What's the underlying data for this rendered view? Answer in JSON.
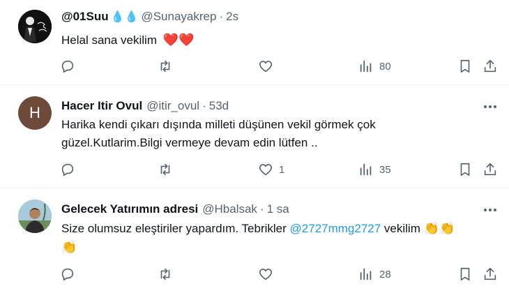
{
  "tweets": [
    {
      "name": "@01Suu",
      "name_suffix": "💧💧",
      "handle": "@Sunayakrep",
      "dot": "·",
      "time": "2s",
      "text": "Helal sana vekilim",
      "text_emoji": "❤️❤️",
      "replies": "",
      "retweets": "",
      "likes": "",
      "views": "80"
    },
    {
      "name": "Hacer Itir Ovul",
      "handle": "@itir_ovul",
      "dot": "·",
      "time": "53d",
      "avatar_letter": "H",
      "text_line1": "Harika kendi çıkarı dışında milleti düşünen vekil görmek çok",
      "text_line2": "güzel.Kutlarim.Bilgi vermeye devam edin lütfen ..",
      "replies": "",
      "retweets": "",
      "likes": "1",
      "views": "35"
    },
    {
      "name": "Gelecek Yatırımın adresi",
      "handle": "@Hbalsak",
      "dot": "·",
      "time": "1 sa",
      "text_before": "Size olumsuz eleştiriler yapardım. Tebrikler ",
      "mention": "@2727mmg2727",
      "text_after": " vekilim",
      "emoji_inline": "👏👏",
      "emoji_line2": "👏",
      "replies": "",
      "retweets": "",
      "likes": "",
      "views": "28"
    }
  ],
  "colors": {
    "accent": "#1d9bf0",
    "muted": "#536471",
    "heart": "#e0245e",
    "divider": "#eff3f4"
  },
  "icons": [
    "reply-icon",
    "retweet-icon",
    "like-icon",
    "views-icon",
    "bookmark-icon",
    "share-icon",
    "more-icon"
  ]
}
